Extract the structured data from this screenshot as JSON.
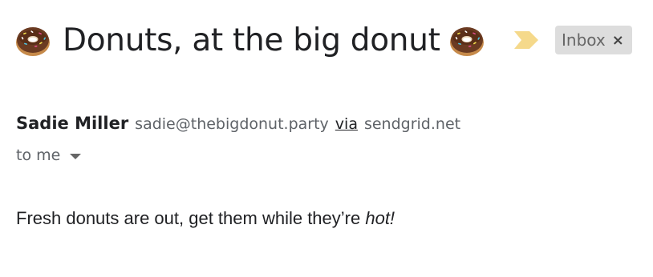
{
  "subject": {
    "text": "Donuts, at the big donut",
    "emoji_icon": "donut-emoji"
  },
  "importance_marker": {
    "icon": "importance-marker-icon",
    "color": "#f5d98b"
  },
  "label_chip": {
    "text": "Inbox",
    "close_glyph": "×",
    "background": "#dddddd"
  },
  "sender": {
    "name": "Sadie Miller",
    "email": "sadie@thebigdonut.party",
    "via_label": "via",
    "via_domain": "sendgrid.net"
  },
  "recipient": {
    "label": "to me",
    "icon": "caret-down-icon"
  },
  "message": {
    "text_plain": "Fresh donuts are out, get them while they’re ",
    "text_emphasis": "hot!"
  }
}
